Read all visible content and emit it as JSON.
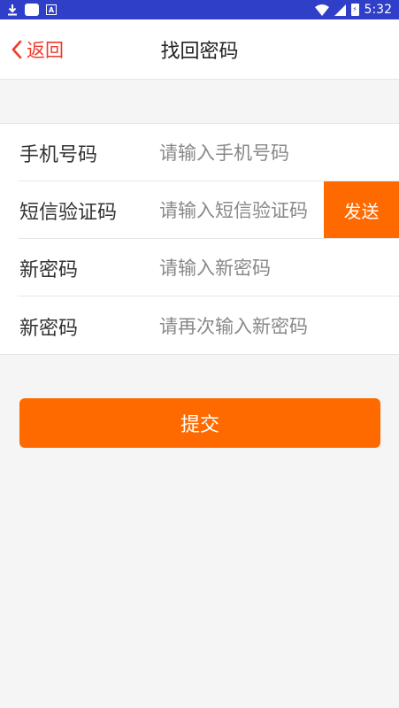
{
  "status_bar": {
    "time": "5:32",
    "icons": [
      "download-icon",
      "app-icon",
      "a-icon",
      "wifi-icon",
      "signal-icon",
      "battery-icon"
    ]
  },
  "nav": {
    "back_label": "返回",
    "title": "找回密码"
  },
  "form": {
    "rows": [
      {
        "label": "手机号码",
        "placeholder": "请输入手机号码"
      },
      {
        "label": "短信验证码",
        "placeholder": "请输入短信验证码"
      },
      {
        "label": "新密码",
        "placeholder": "请输入新密码"
      },
      {
        "label": "新密码",
        "placeholder": "请再次输入新密码"
      }
    ],
    "send_label": "发送"
  },
  "submit_label": "提交",
  "colors": {
    "accent": "#ff6a00",
    "back": "#ee3a2a",
    "status_bar": "#2f3fc7"
  }
}
